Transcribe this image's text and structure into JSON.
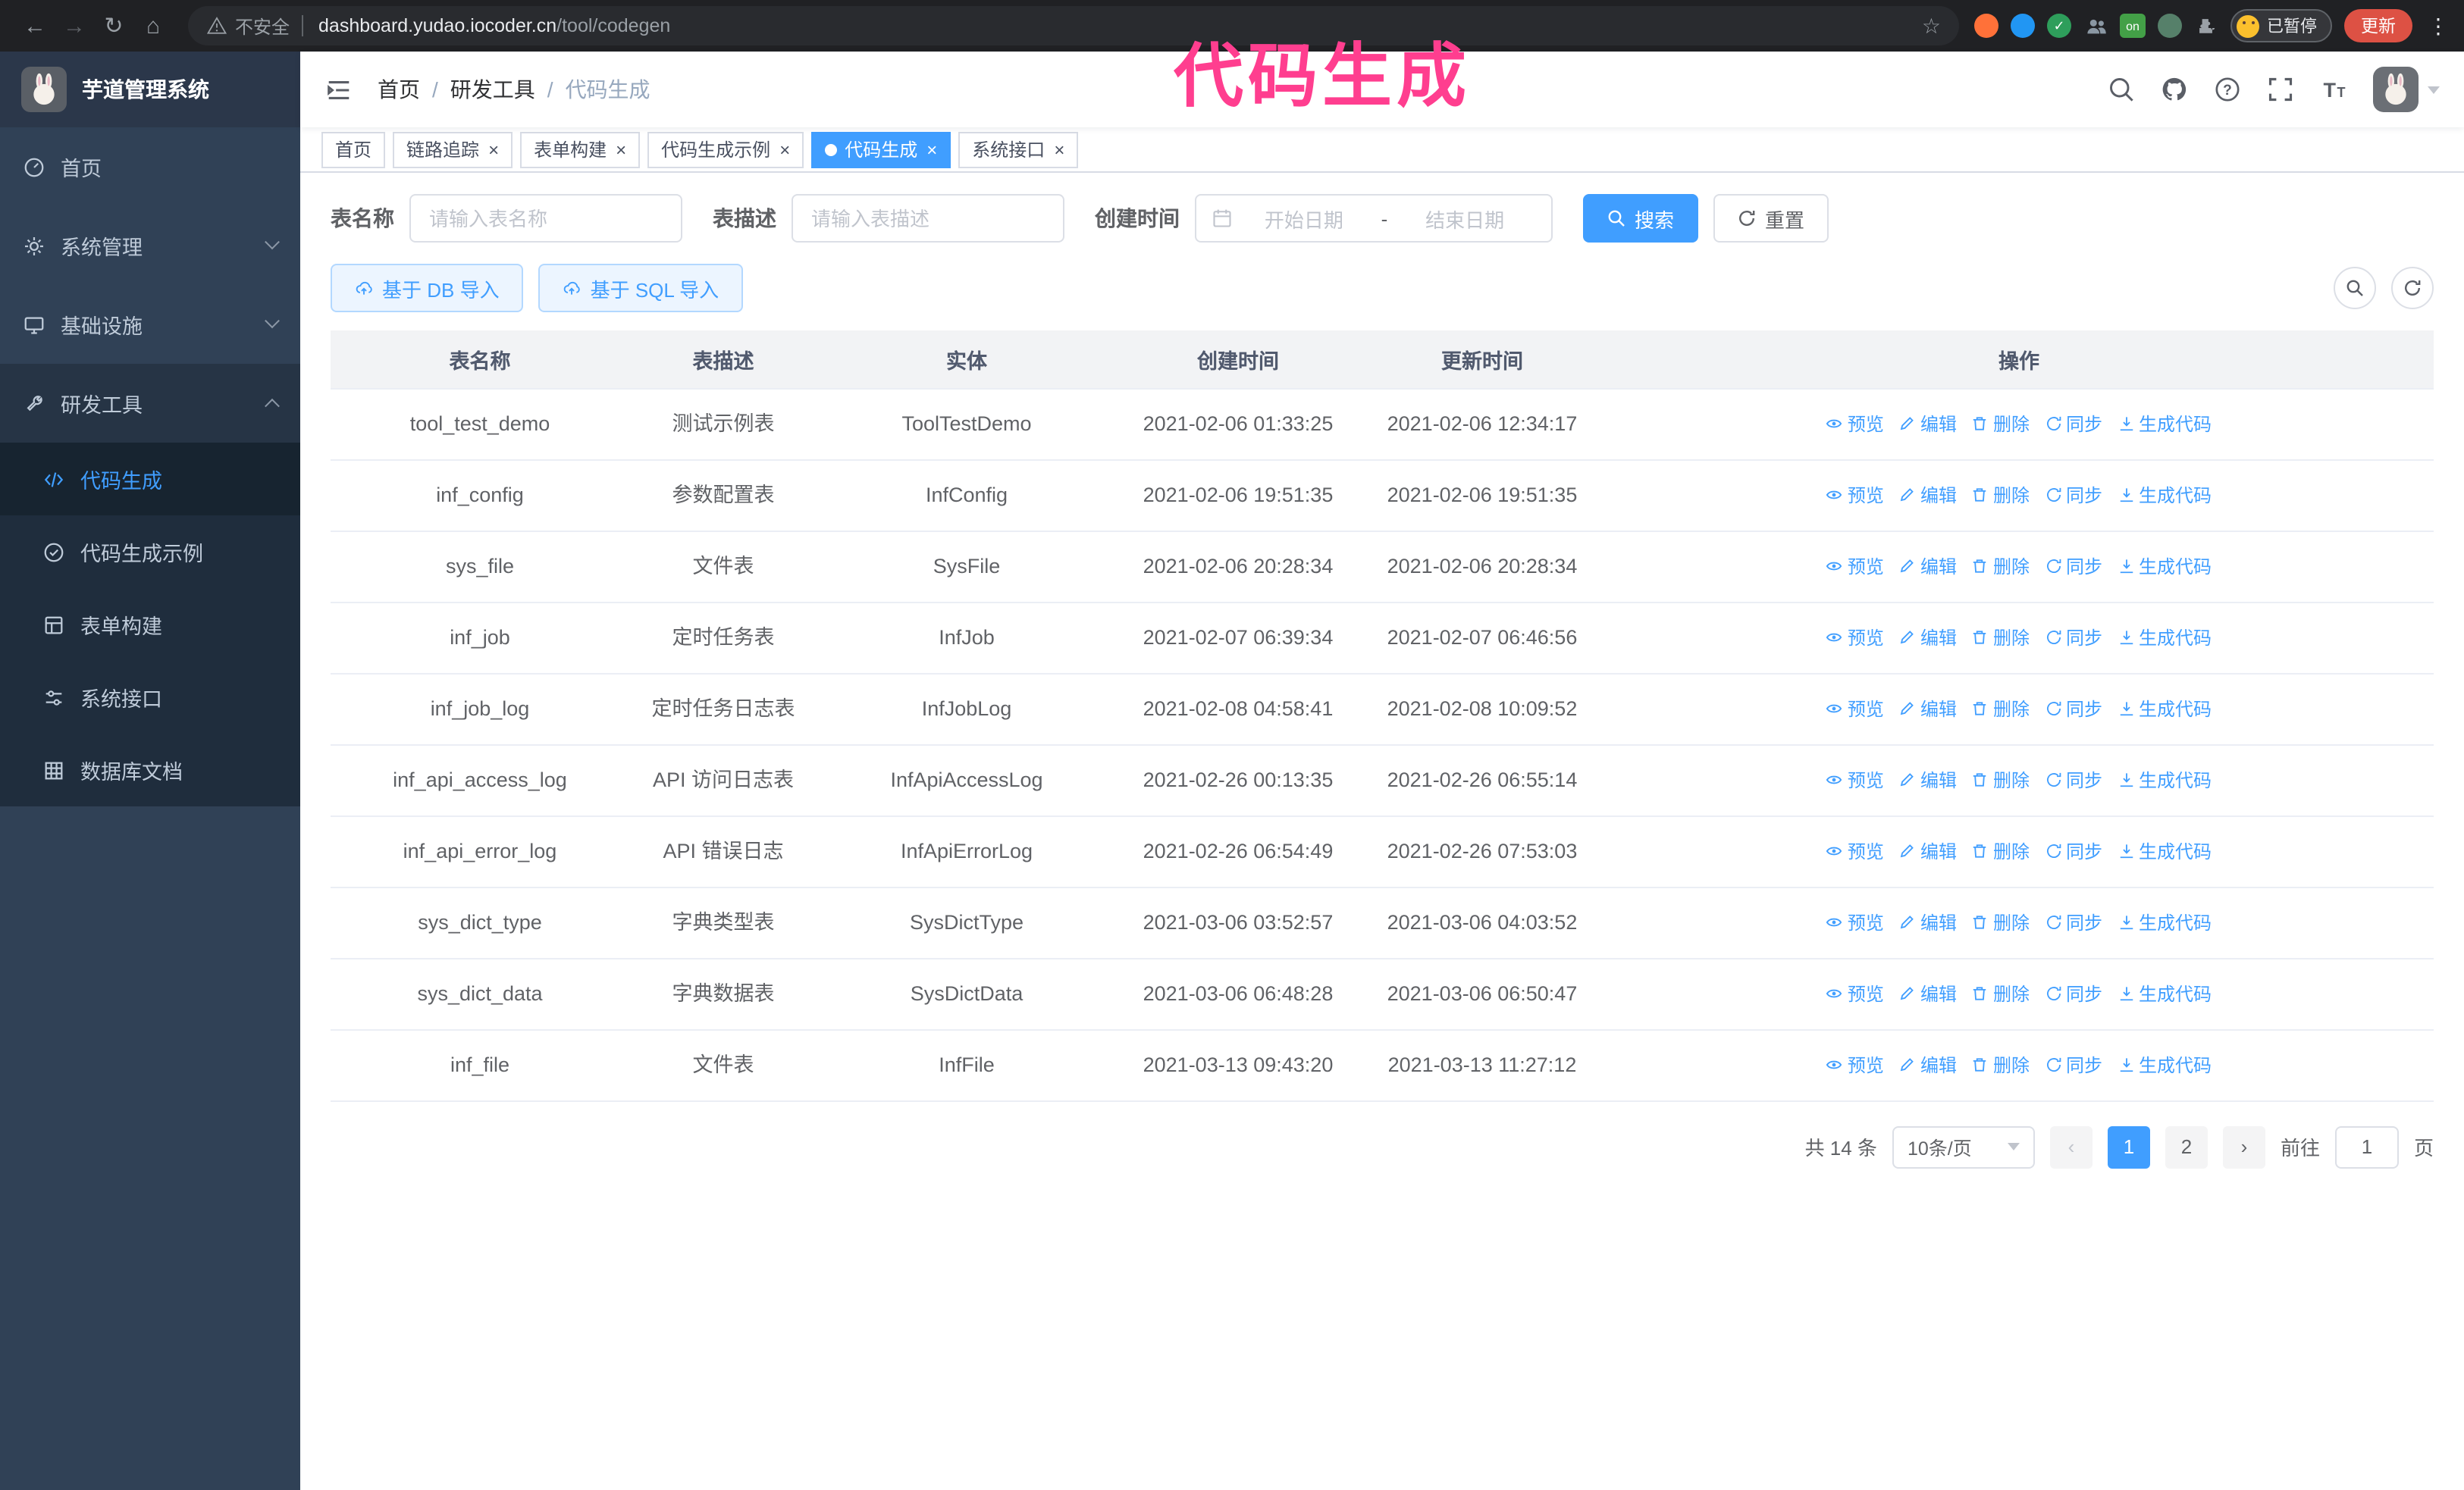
{
  "overlay": {
    "title": "代码生成"
  },
  "theme": {
    "accent": "#409eff",
    "sidebar_bg": "#304156",
    "submenu_bg": "#1f2d3d",
    "chrome_bg": "#202124",
    "overlay_pink": "#ff3e8f",
    "tag_active_bg": "#409eff",
    "update_button_bg": "#dd5144"
  },
  "browser": {
    "security_label": "不安全",
    "url_host": "dashboard.yudao.iocoder.cn",
    "url_path": "/tool/codegen",
    "profile_badge": "已暂停",
    "update_button": "更新",
    "extension_on_label": "on",
    "extensions": [
      {
        "name": "fox-extension-icon",
        "color": "#ff7139"
      },
      {
        "name": "drop-extension-icon",
        "color": "#2196f3"
      },
      {
        "name": "check-extension-icon",
        "color": "#2e9e5b"
      },
      {
        "name": "people-extension-icon",
        "color": "#8a97a3"
      },
      {
        "name": "on-extension-icon",
        "color": "#43a047"
      },
      {
        "name": "leaf-extension-icon",
        "color": "#56806a"
      },
      {
        "name": "puzzle-extension-icon",
        "color": "#9aa0a6"
      }
    ]
  },
  "sidebar": {
    "app_title": "芋道管理系统",
    "items": [
      {
        "label": "首页",
        "icon": "dashboard-icon"
      },
      {
        "label": "系统管理",
        "icon": "gear-icon",
        "chevron": "down"
      },
      {
        "label": "基础设施",
        "icon": "monitor-icon",
        "chevron": "down"
      },
      {
        "label": "研发工具",
        "icon": "tools-icon",
        "chevron": "up",
        "expanded": true
      }
    ],
    "subitems": [
      {
        "label": "代码生成",
        "icon": "code-icon",
        "active": true
      },
      {
        "label": "代码生成示例",
        "icon": "check-circle-icon"
      },
      {
        "label": "表单构建",
        "icon": "form-icon"
      },
      {
        "label": "系统接口",
        "icon": "sliders-icon"
      },
      {
        "label": "数据库文档",
        "icon": "grid-icon"
      }
    ]
  },
  "header": {
    "breadcrumb": [
      "首页",
      "研发工具",
      "代码生成"
    ],
    "icons": [
      "search-icon",
      "github-icon",
      "question-icon",
      "fullscreen-icon",
      "font-size-icon",
      "avatar",
      "chevron-down-icon"
    ]
  },
  "tabs": [
    {
      "label": "首页",
      "closable": false,
      "active": false
    },
    {
      "label": "链路追踪",
      "closable": true,
      "active": false
    },
    {
      "label": "表单构建",
      "closable": true,
      "active": false
    },
    {
      "label": "代码生成示例",
      "closable": true,
      "active": false
    },
    {
      "label": "代码生成",
      "closable": true,
      "active": true
    },
    {
      "label": "系统接口",
      "closable": true,
      "active": false
    }
  ],
  "filters": {
    "name_label": "表名称",
    "name_placeholder": "请输入表名称",
    "desc_label": "表描述",
    "desc_placeholder": "请输入表描述",
    "time_label": "创建时间",
    "start_placeholder": "开始日期",
    "range_separator": "-",
    "end_placeholder": "结束日期",
    "search_button": "搜索",
    "reset_button": "重置"
  },
  "toolbar": {
    "import_db": "基于 DB 导入",
    "import_sql": "基于 SQL 导入"
  },
  "table": {
    "columns": [
      "表名称",
      "表描述",
      "实体",
      "创建时间",
      "更新时间",
      "操作"
    ],
    "action_labels": [
      "预览",
      "编辑",
      "删除",
      "同步",
      "生成代码"
    ],
    "rows": [
      {
        "name": "tool_test_demo",
        "desc": "测试示例表",
        "entity": "ToolTestDemo",
        "created": "2021-02-06 01:33:25",
        "updated": "2021-02-06 12:34:17"
      },
      {
        "name": "inf_config",
        "desc": "参数配置表",
        "entity": "InfConfig",
        "created": "2021-02-06 19:51:35",
        "updated": "2021-02-06 19:51:35"
      },
      {
        "name": "sys_file",
        "desc": "文件表",
        "entity": "SysFile",
        "created": "2021-02-06 20:28:34",
        "updated": "2021-02-06 20:28:34"
      },
      {
        "name": "inf_job",
        "desc": "定时任务表",
        "entity": "InfJob",
        "created": "2021-02-07 06:39:34",
        "updated": "2021-02-07 06:46:56"
      },
      {
        "name": "inf_job_log",
        "desc": "定时任务日志表",
        "entity": "InfJobLog",
        "created": "2021-02-08 04:58:41",
        "updated": "2021-02-08 10:09:52"
      },
      {
        "name": "inf_api_access_log",
        "desc": "API 访问日志表",
        "entity": "InfApiAccessLog",
        "created": "2021-02-26 00:13:35",
        "updated": "2021-02-26 06:55:14"
      },
      {
        "name": "inf_api_error_log",
        "desc": "API 错误日志",
        "entity": "InfApiErrorLog",
        "created": "2021-02-26 06:54:49",
        "updated": "2021-02-26 07:53:03"
      },
      {
        "name": "sys_dict_type",
        "desc": "字典类型表",
        "entity": "SysDictType",
        "created": "2021-03-06 03:52:57",
        "updated": "2021-03-06 04:03:52"
      },
      {
        "name": "sys_dict_data",
        "desc": "字典数据表",
        "entity": "SysDictData",
        "created": "2021-03-06 06:48:28",
        "updated": "2021-03-06 06:50:47"
      },
      {
        "name": "inf_file",
        "desc": "文件表",
        "entity": "InfFile",
        "created": "2021-03-13 09:43:20",
        "updated": "2021-03-13 11:27:12"
      }
    ]
  },
  "pagination": {
    "total_text": "共 14 条",
    "page_size": "10条/页",
    "pages": [
      "1",
      "2"
    ],
    "active_page": "1",
    "goto_label": "前往",
    "goto_value": "1",
    "goto_suffix": "页"
  }
}
